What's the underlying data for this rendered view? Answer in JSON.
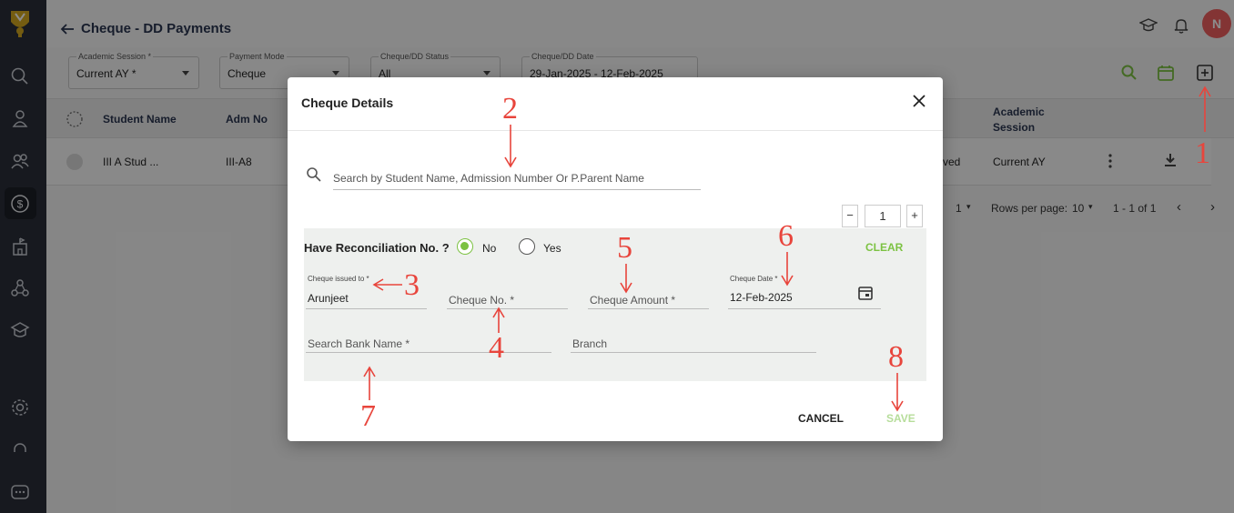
{
  "header": {
    "title": "Cheque - DD Payments",
    "avatar_initial": "N"
  },
  "filters": [
    {
      "label": "Academic Session *",
      "value": "Current AY *"
    },
    {
      "label": "Payment Mode",
      "value": "Cheque"
    },
    {
      "label": "Cheque/DD Status",
      "value": "All"
    },
    {
      "label": "Cheque/DD Date",
      "value": "29-Jan-2025 - 12-Feb-2025"
    }
  ],
  "table": {
    "headers": {
      "student_name": "Student Name",
      "adm_no": "Adm No",
      "academic_session_1": "Academic",
      "academic_session_2": "Session"
    },
    "rows": [
      {
        "student_name": "III A Stud ...",
        "adm_no": "III-A8",
        "status_partial": "ved",
        "academic_session": "Current AY"
      }
    ]
  },
  "pagination": {
    "page": "1",
    "rows_per_page_label": "Rows per page:",
    "rows_per_page": "10",
    "range": "1 - 1 of 1"
  },
  "modal": {
    "title": "Cheque Details",
    "search_placeholder": "Search by Student Name, Admission Number Or P.Parent Name",
    "stepper_value": "1",
    "recon_label": "Have Reconciliation No. ?",
    "option_no": "No",
    "option_yes": "Yes",
    "selected": "No",
    "clear_label": "CLEAR",
    "cheque_issued_to_label": "Cheque issued to *",
    "cheque_issued_to_value": "Arunjeet",
    "cheque_no_placeholder": "Cheque No. *",
    "cheque_amount_placeholder": "Cheque Amount *",
    "cheque_date_label": "Cheque Date *",
    "cheque_date_value": "12-Feb-2025",
    "bank_placeholder": "Search Bank Name *",
    "branch_placeholder": "Branch",
    "cancel_label": "CANCEL",
    "save_label": "SAVE"
  },
  "annotations": [
    "1",
    "2",
    "3",
    "4",
    "5",
    "6",
    "7",
    "8"
  ],
  "colors": {
    "accent": "#7cc242",
    "annotation": "#e8453c",
    "sidebar": "#2b2f3a",
    "avatar": "#ef5f5f"
  }
}
